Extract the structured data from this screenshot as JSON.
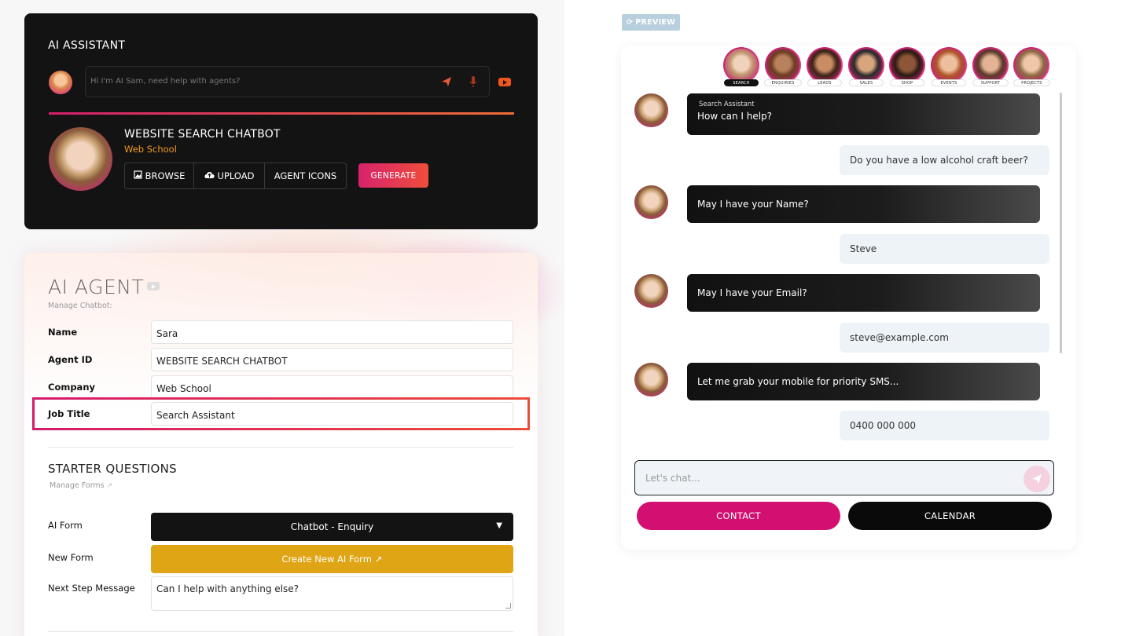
{
  "assistant": {
    "title": "AI ASSISTANT",
    "input_placeholder": "Hi I'm AI Sam, need help with agents?"
  },
  "agent_header": {
    "name": "WEBSITE SEARCH CHATBOT",
    "company": "Web School",
    "buttons": [
      "BROWSE",
      "UPLOAD",
      "AGENT ICONS"
    ],
    "generate_label": "GENERATE"
  },
  "agent_panel": {
    "title": "AI AGENT",
    "subtitle": "Manage Chatbot:",
    "fields": [
      {
        "label": "Name",
        "value": "Sara"
      },
      {
        "label": "Agent ID",
        "value": "WEBSITE SEARCH CHATBOT"
      },
      {
        "label": "Company",
        "value": "Web School"
      },
      {
        "label": "Job Title",
        "value": "Search Assistant"
      }
    ]
  },
  "starter": {
    "title": "STARTER QUESTIONS",
    "subtitle": "Manage Forms",
    "ai_form_label": "AI Form",
    "ai_form_value": "Chatbot - Enquiry",
    "new_form_label": "New Form",
    "create_label": "Create New AI Form",
    "next_step_label": "Next Step Message",
    "next_step_value": "Can I help with anything else?"
  },
  "preview": {
    "tag": "PREVIEW",
    "agents": [
      "SEARCH",
      "ENQUIRIES",
      "LEADS",
      "SALES",
      "SHOP",
      "EVENTS",
      "SUPPORT",
      "PROJECTS"
    ],
    "active_agent": "SEARCH",
    "messages": [
      {
        "from": "bot",
        "caption": "Search Assistant",
        "text": "How can I help?"
      },
      {
        "from": "user",
        "text": "Do you have a low alcohol craft beer?"
      },
      {
        "from": "bot",
        "text": "May I have your Name?"
      },
      {
        "from": "user",
        "text": "Steve"
      },
      {
        "from": "bot",
        "text": "May I have your Email?"
      },
      {
        "from": "user",
        "text": "steve@example.com"
      },
      {
        "from": "bot",
        "text": "Let me grab your mobile for priority SMS..."
      },
      {
        "from": "user",
        "text": "0400 000 000"
      }
    ],
    "input_placeholder": "Let's chat...",
    "contact_label": "CONTACT",
    "calendar_label": "CALENDAR"
  },
  "colors": {
    "accent_pink": "#d30f72",
    "accent_orange": "#ee4e3b",
    "gold": "#dfa514",
    "dark": "#131313"
  }
}
